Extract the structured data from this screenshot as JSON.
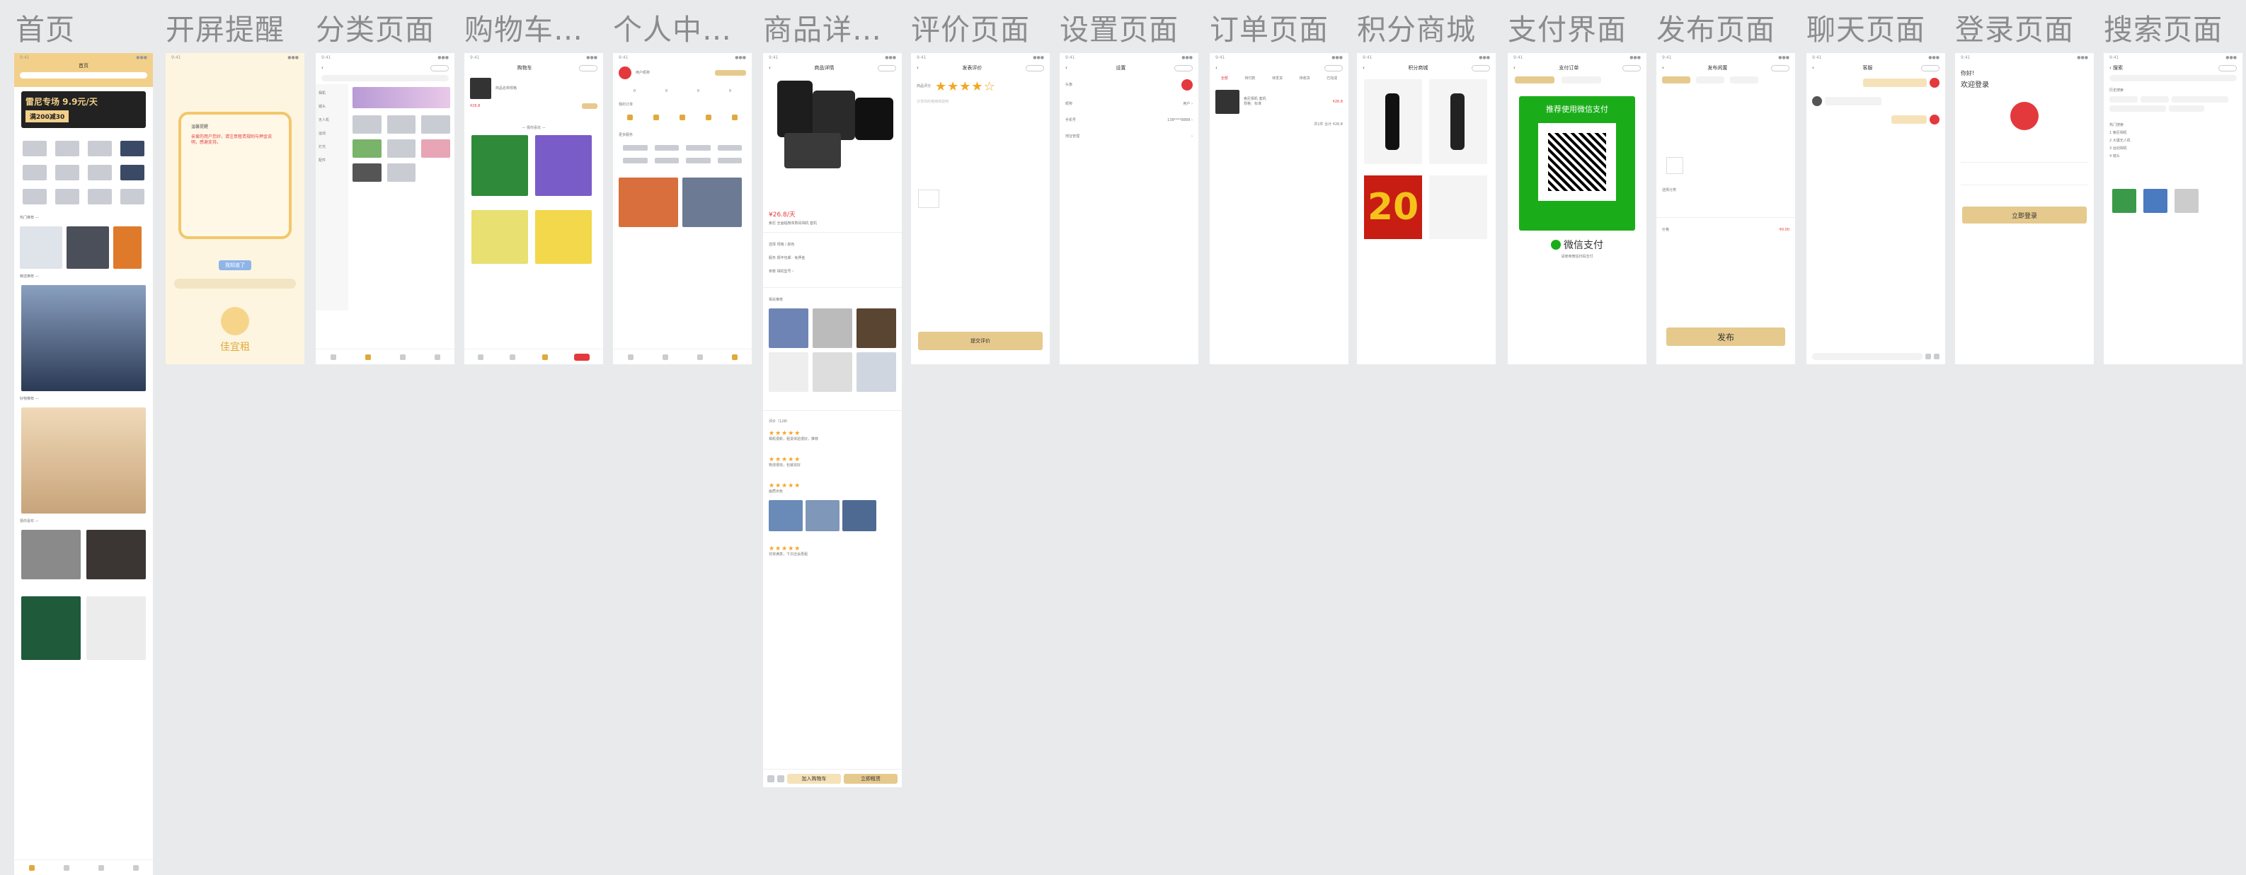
{
  "titles": [
    "首页",
    "开屏提醒",
    "分类页面",
    "购物车…",
    "个人中…",
    "商品详…",
    "评价页面",
    "设置页面",
    "订单页面",
    "积分商城",
    "支付界面",
    "发布页面",
    "聊天页面",
    "登录页面",
    "搜索页面"
  ],
  "home": {
    "banner": "雷尼专场 9.9元/天",
    "banner_sub": "满200减30"
  },
  "splash": {
    "btn": "我知道了",
    "logo": "佳宜租"
  },
  "pay": {
    "title": "推荐使用微信支付",
    "wechat": "微信支付",
    "note": "请使用微信扫码支付"
  },
  "points": {
    "big": "20"
  },
  "publish": {
    "btn": "发布"
  },
  "login": {
    "greet": "你好!",
    "welcome": "欢迎登录",
    "btn": "立即登录"
  },
  "detail": {
    "price": "¥26.8/天",
    "buy": "立即租赁",
    "cart": "加入购物车"
  },
  "review": {
    "submit": "提交评价"
  },
  "colors": {
    "gold": "#e6c98d",
    "red": "#e4393c",
    "green": "#1aad19",
    "bg": "#e9eaec"
  }
}
